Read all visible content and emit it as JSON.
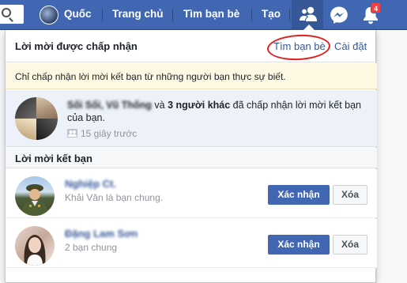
{
  "topbar": {
    "profile_name": "Quốc",
    "nav_home": "Trang chủ",
    "nav_find_friends": "Tìm bạn bè",
    "nav_create": "Tạo",
    "notification_count": "4"
  },
  "panel": {
    "header_title": "Lời mời được chấp nhận",
    "find_friends_link": "Tìm bạn bè",
    "separator": "·",
    "settings_link": "Cài đặt",
    "notice": "Chỉ chấp nhận lời mời kết bạn từ những người bạn thực sự biết.",
    "accepted": {
      "names": "Sối Sối, Vũ Thống",
      "and_word": "và",
      "others": "3 người khác",
      "message": "đã chấp nhận lời mời kết bạn của bạn.",
      "time": "15 giây trước"
    },
    "requests_title": "Lời mời kết bạn",
    "requests": [
      {
        "name": "Nghiệp Ct.",
        "mutual": "Khải Văn là bạn chung.",
        "confirm_label": "Xác nhận",
        "delete_label": "Xóa"
      },
      {
        "name": "Đặng Lam Sơn",
        "mutual": "2 bạn chung",
        "confirm_label": "Xác nhận",
        "delete_label": "Xóa"
      }
    ]
  },
  "colors": {
    "brand_blue": "#4267b2",
    "link_blue": "#365899",
    "annotation_red": "#e02020",
    "badge_red": "#fa3e3e"
  }
}
